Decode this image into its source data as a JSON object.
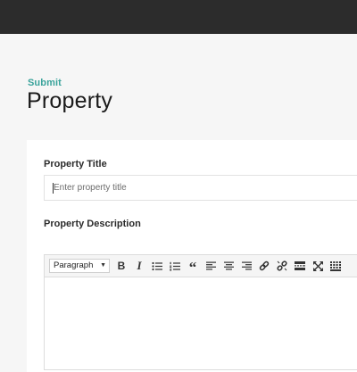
{
  "header": {
    "subtitle": "Submit",
    "title": "Property"
  },
  "form": {
    "title_field": {
      "label": "Property Title",
      "placeholder": "Enter property title",
      "value": ""
    },
    "description_field": {
      "label": "Property Description"
    }
  },
  "editor": {
    "format_select": {
      "selected": "Paragraph"
    },
    "toolbar": [
      {
        "name": "bold-button",
        "glyph": "B"
      },
      {
        "name": "italic-button",
        "glyph": "I"
      },
      {
        "name": "bullet-list-button",
        "icon": "bullet-list-icon"
      },
      {
        "name": "numbered-list-button",
        "icon": "numbered-list-icon"
      },
      {
        "name": "blockquote-button",
        "glyph": "“"
      },
      {
        "name": "align-left-button",
        "icon": "align-left-icon"
      },
      {
        "name": "align-center-button",
        "icon": "align-center-icon"
      },
      {
        "name": "align-right-button",
        "icon": "align-right-icon"
      },
      {
        "name": "insert-link-button",
        "icon": "link-icon"
      },
      {
        "name": "remove-link-button",
        "icon": "unlink-icon"
      },
      {
        "name": "read-more-button",
        "icon": "read-more-icon"
      },
      {
        "name": "fullscreen-button",
        "icon": "fullscreen-icon"
      },
      {
        "name": "toolbar-toggle-button",
        "icon": "keyboard-icon"
      }
    ]
  },
  "colors": {
    "topbar": "#2c2c2c",
    "accent": "#3aa39b",
    "page_background": "#f6f6f6",
    "card_background": "#ffffff"
  }
}
